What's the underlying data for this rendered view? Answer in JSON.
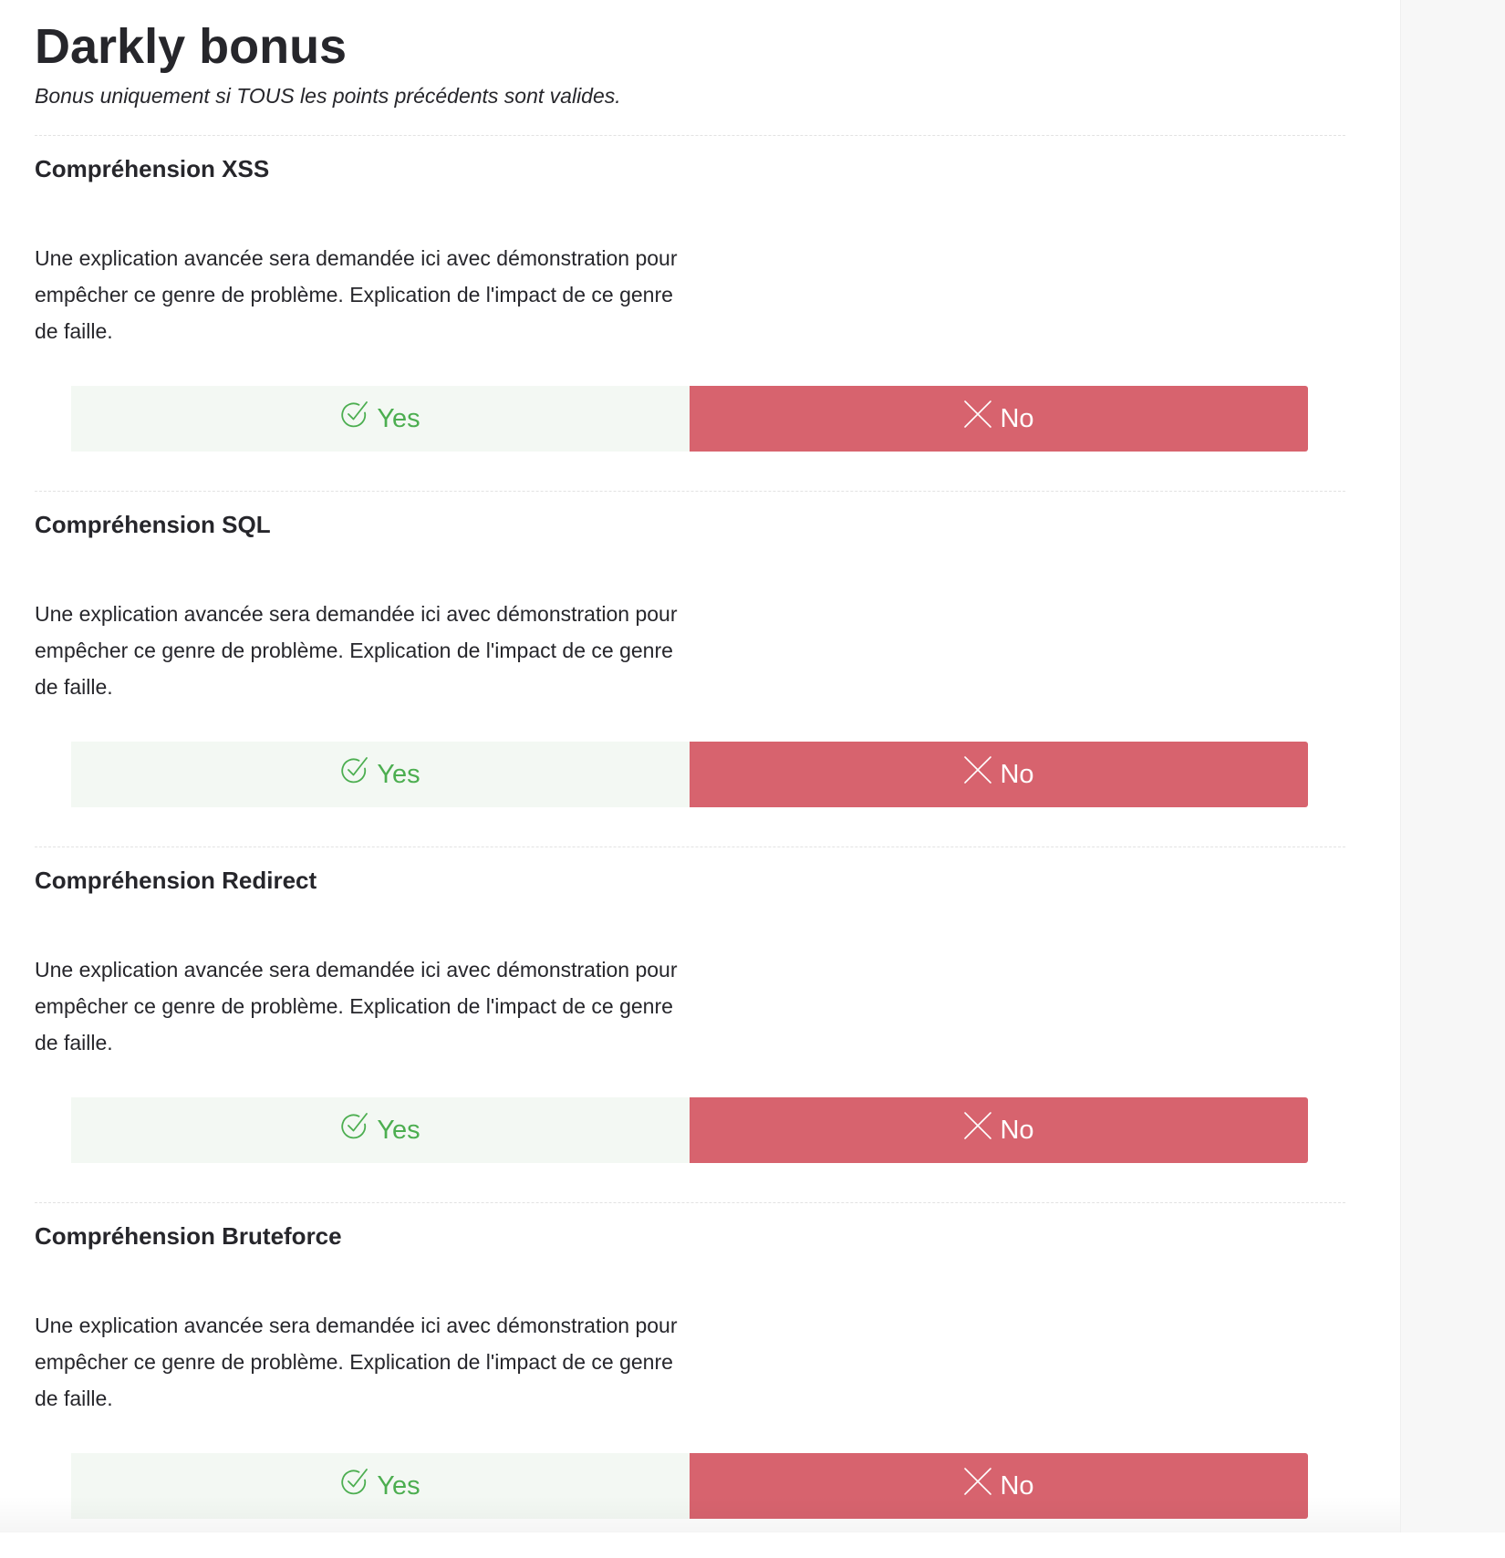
{
  "header": {
    "title": "Darkly bonus",
    "subtitle": "Bonus uniquement si TOUS les points précédents sont valides."
  },
  "colors": {
    "yes_bg": "#f3f8f3",
    "yes_text": "#4cae50",
    "no_bg": "#d7636e",
    "no_text": "#ffffff"
  },
  "icons": {
    "yes": "check-circle-icon",
    "no": "close-icon"
  },
  "sections": [
    {
      "title": "Compréhension XSS",
      "description": "Une explication avancée sera demandée ici avec démonstration pour empêcher ce genre de problème. Explication de l'impact de ce genre de faille.",
      "yes_label": "Yes",
      "no_label": "No",
      "selected": "No"
    },
    {
      "title": "Compréhension SQL",
      "description": "Une explication avancée sera demandée ici avec démonstration pour empêcher ce genre de problème. Explication de l'impact de ce genre de faille.",
      "yes_label": "Yes",
      "no_label": "No",
      "selected": "No"
    },
    {
      "title": "Compréhension Redirect",
      "description": "Une explication avancée sera demandée ici avec démonstration pour empêcher ce genre de problème. Explication de l'impact de ce genre de faille.",
      "yes_label": "Yes",
      "no_label": "No",
      "selected": "No"
    },
    {
      "title": "Compréhension Bruteforce",
      "description": "Une explication avancée sera demandée ici avec démonstration pour empêcher ce genre de problème. Explication de l'impact de ce genre de faille.",
      "yes_label": "Yes",
      "no_label": "No",
      "selected": "No"
    }
  ]
}
